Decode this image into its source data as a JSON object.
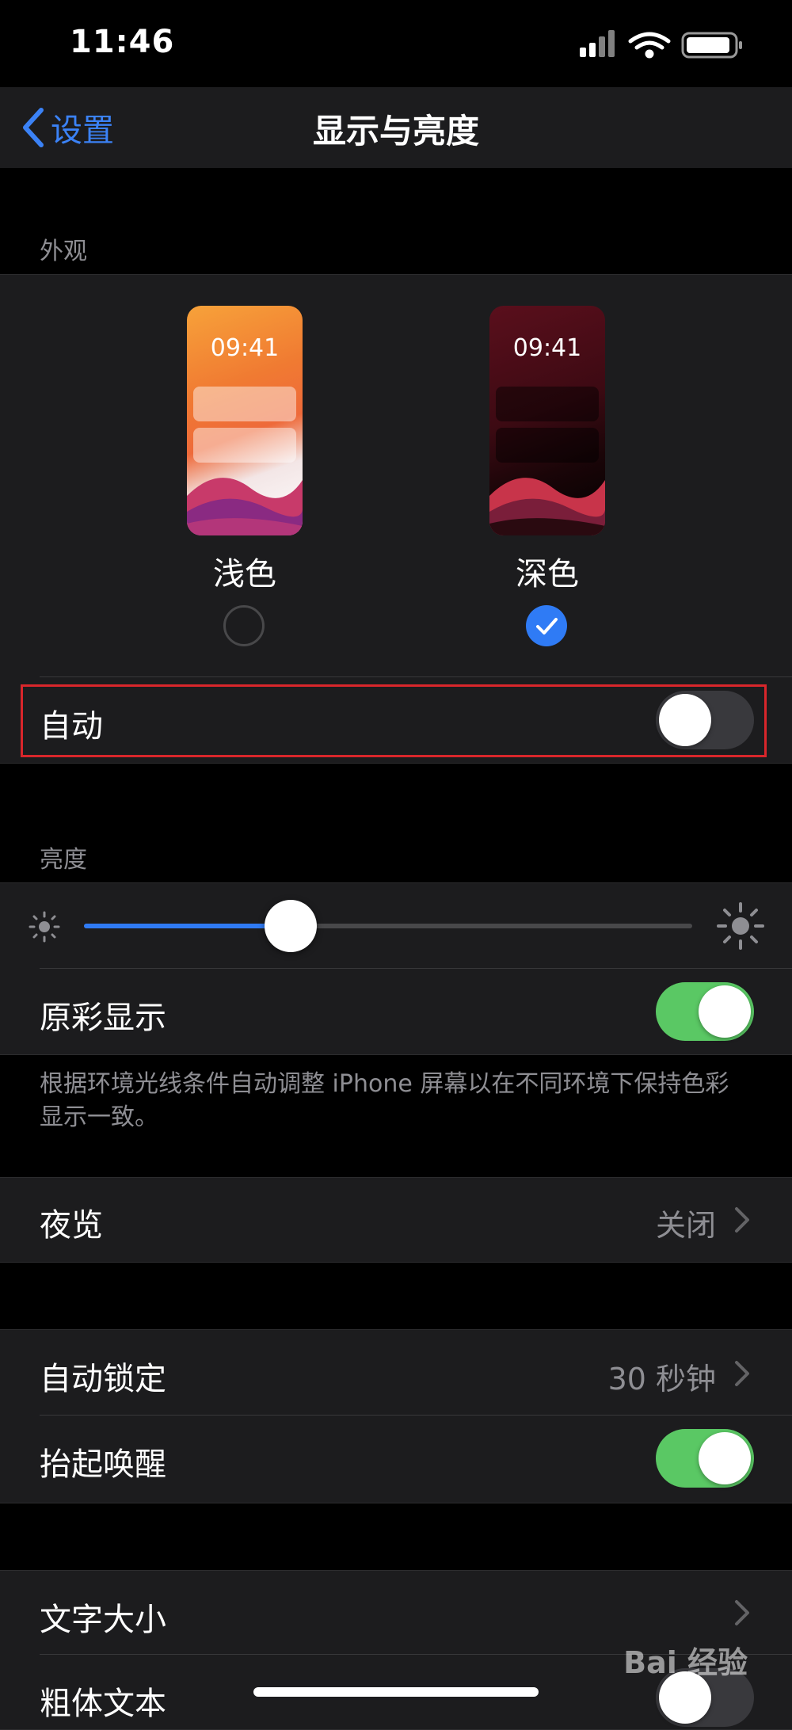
{
  "status_bar": {
    "time": "11:46"
  },
  "nav": {
    "back_label": "设置",
    "title": "显示与亮度"
  },
  "appearance": {
    "header": "外观",
    "light": {
      "label": "浅色",
      "thumb_time": "09:41",
      "selected": false
    },
    "dark": {
      "label": "深色",
      "thumb_time": "09:41",
      "selected": true
    },
    "auto": {
      "label": "自动",
      "on": false
    }
  },
  "brightness": {
    "header": "亮度",
    "level": 0.34,
    "true_tone": {
      "label": "原彩显示",
      "on": true
    },
    "footnote": "根据环境光线条件自动调整 iPhone 屏幕以在不同环境下保持色彩显示一致。"
  },
  "night_shift": {
    "label": "夜览",
    "value": "关闭"
  },
  "lock": {
    "auto_lock": {
      "label": "自动锁定",
      "value": "30 秒钟"
    },
    "raise_to_wake": {
      "label": "抬起唤醒",
      "on": true
    }
  },
  "text": {
    "text_size": {
      "label": "文字大小"
    },
    "bold_text": {
      "label": "粗体文本",
      "on": false
    }
  },
  "watermark": "Bai 经验",
  "colors": {
    "accent": "#2f7bf5",
    "toggle_on": "#5ac864",
    "highlight": "#d9262b"
  }
}
